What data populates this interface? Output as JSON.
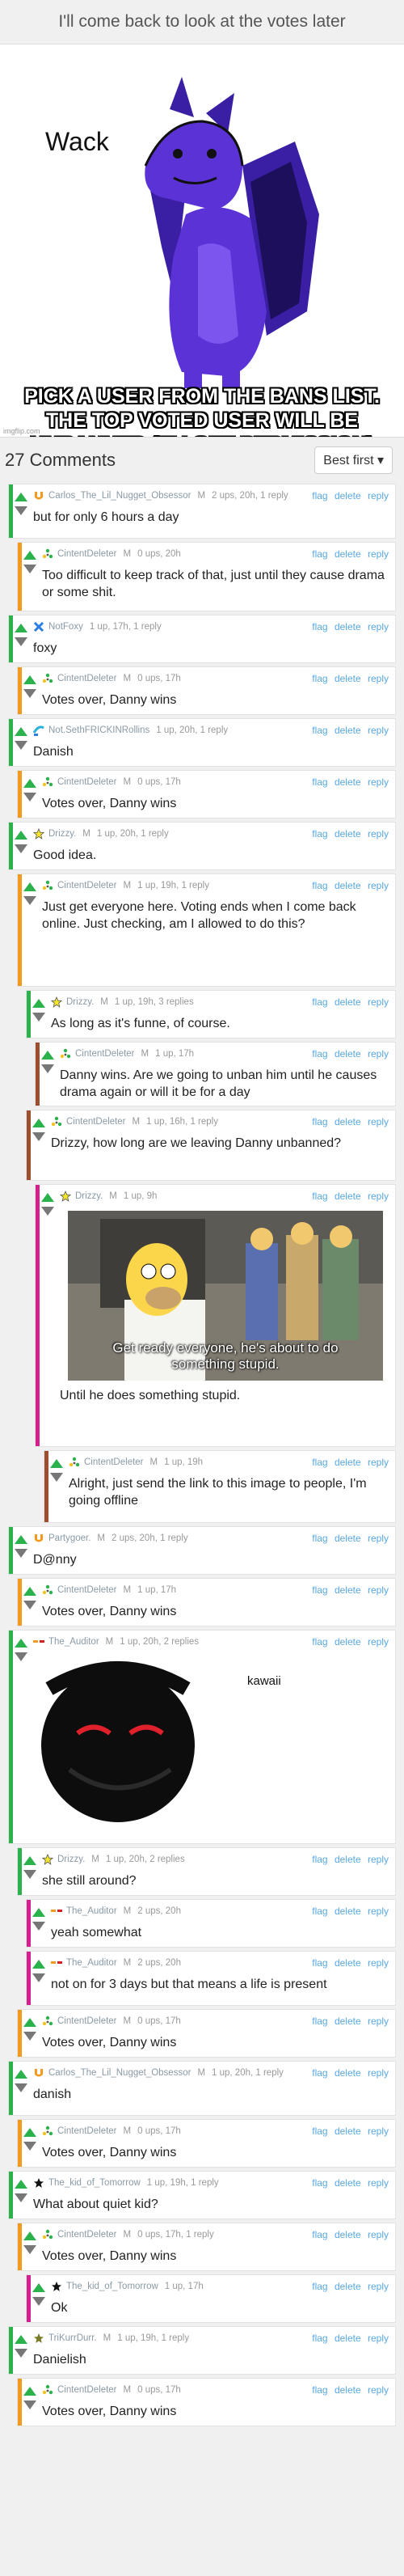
{
  "header": {
    "title": "I'll come back to look at the votes later"
  },
  "meme": {
    "label": "Wack",
    "caption": "PICK A USER FROM THE BANS LIST. THE TOP VOTED USER WILL BE UNBANNED (IF I GET PERMISSION)",
    "watermark": "imgflip.com"
  },
  "comments_bar": {
    "count_label": "27 Comments",
    "sort_label": "Best first ▾"
  },
  "actions": {
    "flag": "flag",
    "delete": "delete",
    "reply": "reply"
  },
  "colors": {
    "accent_blue": "#59a8e0",
    "upvote_green": "#2bb24c",
    "downvote_grey": "#777777",
    "orange": "#f39a1e",
    "magenta": "#d61f8e"
  },
  "comments": [
    {
      "user": "Carlos_The_Lil_Nugget_Obsessor",
      "mod": "M",
      "meta": "2 ups, 20h, 1 reply",
      "text": "but for only 6 hours a day",
      "avatar": "orange-u-icon"
    },
    {
      "user": "CintentDeleter",
      "mod": "M",
      "meta": "0 ups, 20h",
      "text": "Too difficult to keep track of that, just until they cause drama or some shit.",
      "avatar": "green-dots-icon"
    },
    {
      "user": "NotFoxy",
      "mod": "",
      "meta": "1 up, 17h, 1 reply",
      "text": "foxy",
      "avatar": "blue-x-icon"
    },
    {
      "user": "CintentDeleter",
      "mod": "M",
      "meta": "0 ups, 17h",
      "text": "Votes over, Danny wins",
      "avatar": "green-dots-icon"
    },
    {
      "user": "Not.SethFRICKINRollins",
      "mod": "",
      "meta": "1 up, 20h, 1 reply",
      "text": "Danish",
      "avatar": "blue-swoosh-icon"
    },
    {
      "user": "CintentDeleter",
      "mod": "M",
      "meta": "0 ups, 17h",
      "text": "Votes over, Danny wins",
      "avatar": "green-dots-icon"
    },
    {
      "user": "Drizzy.",
      "mod": "M",
      "meta": "1 up, 20h, 1 reply",
      "text": "Good idea.",
      "avatar": "star-icon"
    },
    {
      "user": "CintentDeleter",
      "mod": "M",
      "meta": "1 up, 19h, 1 reply",
      "text": "Just get everyone here. Voting ends when I come back online. Just checking, am I allowed to do this?",
      "avatar": "green-dots-icon"
    },
    {
      "user": "Drizzy.",
      "mod": "M",
      "meta": "1 up, 19h, 3 replies",
      "text": "As long as it's funne, of course.",
      "avatar": "star-icon"
    },
    {
      "user": "CintentDeleter",
      "mod": "M",
      "meta": "1 up, 17h",
      "text": "Danny wins. Are we going to unban him until he causes drama again or will it be for a day",
      "avatar": "green-dots-icon"
    },
    {
      "user": "CintentDeleter",
      "mod": "M",
      "meta": "1 up, 16h, 1 reply",
      "text": "Drizzy, how long are we leaving Danny unbanned?",
      "avatar": "green-dots-icon"
    },
    {
      "user": "Drizzy.",
      "mod": "M",
      "meta": "1 up, 9h",
      "text": "Until he does something stupid.",
      "avatar": "star-icon",
      "image_caption": "Get ready everyone, he's about to do something stupid."
    },
    {
      "user": "CintentDeleter",
      "mod": "M",
      "meta": "1 up, 19h",
      "text": "Alright, just send the link to this image to people, I'm going offline",
      "avatar": "green-dots-icon"
    },
    {
      "user": "Partygoer.",
      "mod": "M",
      "meta": "2 ups, 20h, 1 reply",
      "text": "D@nny",
      "avatar": "orange-u-icon"
    },
    {
      "user": "CintentDeleter",
      "mod": "M",
      "meta": "1 up, 17h",
      "text": "Votes over, Danny wins",
      "avatar": "green-dots-icon"
    },
    {
      "user": "The_Auditor",
      "mod": "M",
      "meta": "1 up, 20h, 2 replies",
      "text": "",
      "avatar": "orange-dash-icon",
      "image_caption": "kawaii"
    },
    {
      "user": "Drizzy.",
      "mod": "M",
      "meta": "1 up, 20h, 2 replies",
      "text": "she still around?",
      "avatar": "star-icon"
    },
    {
      "user": "The_Auditor",
      "mod": "M",
      "meta": "2 ups, 20h",
      "text": "yeah somewhat",
      "avatar": "orange-dash-icon"
    },
    {
      "user": "The_Auditor",
      "mod": "M",
      "meta": "2 ups, 20h",
      "text": "not on for 3 days but that means a life is present",
      "avatar": "orange-dash-icon"
    },
    {
      "user": "CintentDeleter",
      "mod": "M",
      "meta": "0 ups, 17h",
      "text": "Votes over, Danny wins",
      "avatar": "green-dots-icon"
    },
    {
      "user": "Carlos_The_Lil_Nugget_Obsessor",
      "mod": "M",
      "meta": "1 up, 20h, 1 reply",
      "text": "danish",
      "avatar": "orange-u-icon"
    },
    {
      "user": "CintentDeleter",
      "mod": "M",
      "meta": "0 ups, 17h",
      "text": "Votes over, Danny wins",
      "avatar": "green-dots-icon"
    },
    {
      "user": "The_kid_of_Tomorrow",
      "mod": "",
      "meta": "1 up, 19h, 1 reply",
      "text": "What about quiet kid?",
      "avatar": "black-star-icon"
    },
    {
      "user": "CintentDeleter",
      "mod": "M",
      "meta": "0 ups, 17h, 1 reply",
      "text": "Votes over, Danny wins",
      "avatar": "green-dots-icon"
    },
    {
      "user": "The_kid_of_Tomorrow",
      "mod": "",
      "meta": "1 up, 17h",
      "text": "Ok",
      "avatar": "black-star-icon"
    },
    {
      "user": "TriKurrDurr.",
      "mod": "M",
      "meta": "1 up, 19h, 1 reply",
      "text": "Danielish",
      "avatar": "olive-star-icon"
    },
    {
      "user": "CintentDeleter",
      "mod": "M",
      "meta": "0 ups, 17h",
      "text": "Votes over, Danny wins",
      "avatar": "green-dots-icon"
    }
  ]
}
